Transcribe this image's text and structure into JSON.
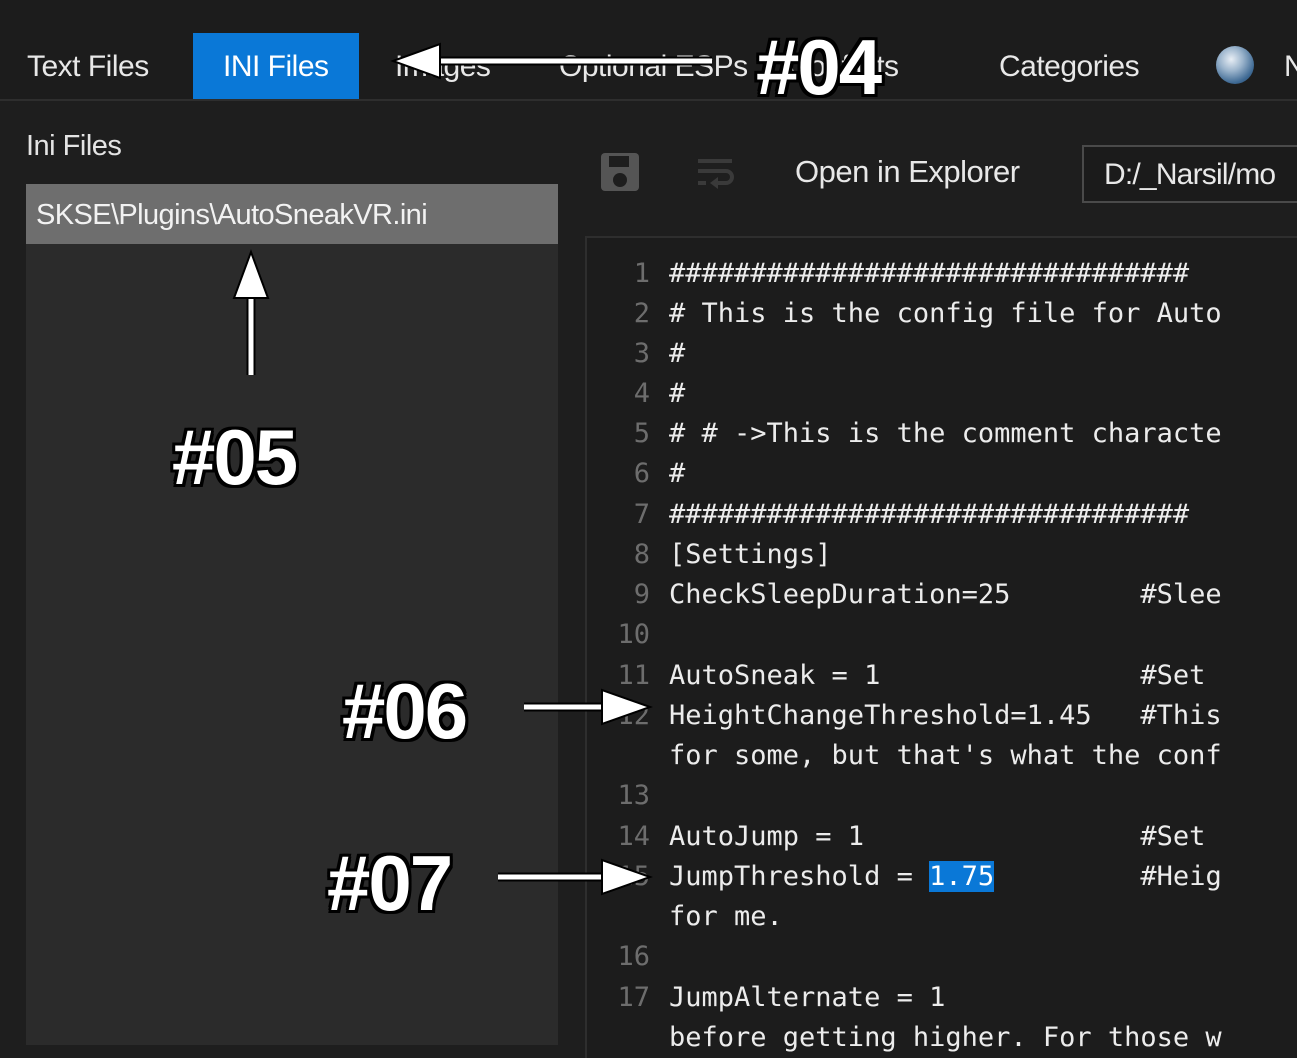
{
  "tabs": [
    {
      "label": "Text Files",
      "active": false
    },
    {
      "label": "INI Files",
      "active": true
    },
    {
      "label": "Images",
      "active": false
    },
    {
      "label": "Optional ESPs",
      "active": false
    },
    {
      "label": "Conflicts",
      "active": false
    },
    {
      "label": "Categories",
      "active": false
    }
  ],
  "tab_more_label": "N",
  "left_panel": {
    "title": "Ini Files",
    "files": [
      "SKSE\\Plugins\\AutoSneakVR.ini"
    ]
  },
  "toolbar": {
    "save_icon": "save-icon",
    "wrap_icon": "word-wrap-icon",
    "open_explorer_label": "Open in Explorer",
    "path_value": "D:/_Narsil/mo"
  },
  "editor": {
    "lines": [
      {
        "n": "1",
        "text": "################################"
      },
      {
        "n": "2",
        "text": "# This is the config file for Auto"
      },
      {
        "n": "3",
        "text": "#"
      },
      {
        "n": "4",
        "text": "#"
      },
      {
        "n": "5",
        "text": "# # ->This is the comment characte"
      },
      {
        "n": "6",
        "text": "#"
      },
      {
        "n": "7",
        "text": "################################"
      },
      {
        "n": "8",
        "text": "[Settings]"
      },
      {
        "n": "9",
        "text": "CheckSleepDuration=25        #Slee"
      },
      {
        "n": "10",
        "text": ""
      },
      {
        "n": "11",
        "text": "AutoSneak = 1                #Set "
      },
      {
        "n": "12",
        "text": "HeightChangeThreshold=1.45   #This"
      },
      {
        "n": "",
        "text": "for some, but that's what the conf"
      },
      {
        "n": "13",
        "text": ""
      },
      {
        "n": "14",
        "text": "AutoJump = 1                 #Set "
      },
      {
        "n": "15",
        "text_before": "JumpThreshold = ",
        "text_selected": "1.75",
        "text_after": "         #Heig"
      },
      {
        "n": "",
        "text": "for me."
      },
      {
        "n": "16",
        "text": ""
      },
      {
        "n": "17",
        "text": "JumpAlternate = 1"
      },
      {
        "n": "",
        "text": "before getting higher. For those w"
      }
    ]
  },
  "annotations": [
    "#04",
    "#05",
    "#06",
    "#07"
  ],
  "colors": {
    "accent": "#0a78d7",
    "background": "#1e1e1e",
    "selected_file": "#6e6e6e"
  }
}
